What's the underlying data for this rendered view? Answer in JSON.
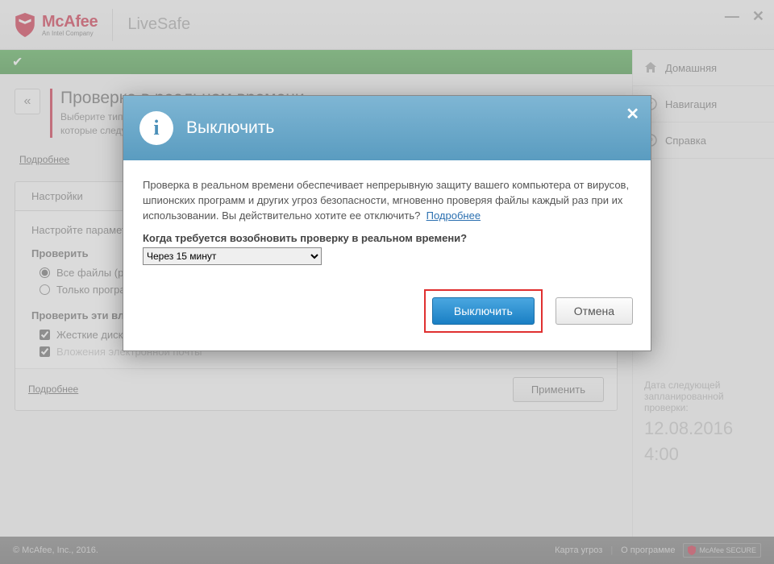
{
  "brand": {
    "name": "McAfee",
    "tagline": "An Intel Company",
    "product": "LiveSafe"
  },
  "win_controls": {
    "minimize": "—",
    "close": "✕"
  },
  "sidebar": {
    "items": [
      {
        "label": "Домашняя"
      },
      {
        "label": "Навигация"
      },
      {
        "label": "Справка"
      }
    ],
    "next_scan_label": "Дата следующей запланированной проверки:",
    "next_scan_date": "12.08.2016",
    "next_scan_time": "4:00"
  },
  "page": {
    "title": "Проверка в реальном времени",
    "subtitle": "Выберите типы файлов, которые необходимо проверять при их использовании, а также угрозы, которые следует искать.",
    "details_link": "Подробнее",
    "settings_tab": "Настройки",
    "settings_hint": "Настройте параметры проверки в реальном времени.",
    "scan_section": "Проверить",
    "opt_all_files": "Все файлы (рекомендуется)",
    "opt_programs": "Только программы и документы",
    "attachments_section": "Проверить эти вложения и расположения",
    "opt_hdd": "Жесткие диски ПК (автоматически)",
    "opt_email": "Вложения электронной почты",
    "apply": "Применить"
  },
  "dialog": {
    "title": "Выключить",
    "body": "Проверка в реальном времени обеспечивает непрерывную защиту вашего компьютера от вирусов, шпионских программ и других угроз безопасности, мгновенно проверяя файлы каждый раз при их использовании. Вы действительно хотите ее отключить?",
    "more_link": "Подробнее",
    "question": "Когда требуется возобновить проверку в реальном времени?",
    "selected_option": "Через 15 минут",
    "confirm": "Выключить",
    "cancel": "Отмена"
  },
  "footer": {
    "copyright": "© McAfee, Inc., 2016.",
    "threat_map": "Карта угроз",
    "about": "О программе",
    "secure_badge": "McAfee SECURE"
  }
}
